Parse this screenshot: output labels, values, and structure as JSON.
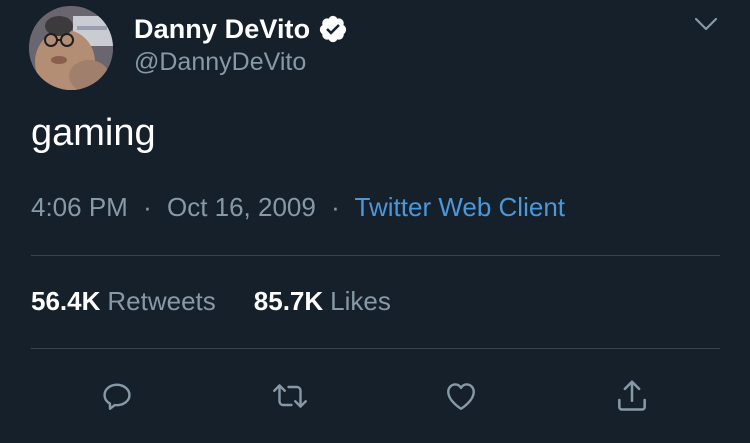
{
  "tweet": {
    "author": {
      "display_name": "Danny DeVito",
      "handle": "@DannyDeVito",
      "verified": true
    },
    "text": "gaming",
    "time": "4:06 PM",
    "date": "Oct 16, 2009",
    "separator": "·",
    "source": "Twitter Web Client",
    "stats": {
      "retweets_count": "56.4K",
      "retweets_label": "Retweets",
      "likes_count": "85.7K",
      "likes_label": "Likes"
    }
  },
  "icons": {
    "caret": "chevron-down-icon",
    "verified": "verified-badge-icon",
    "reply": "reply-icon",
    "retweet": "retweet-icon",
    "like": "heart-icon",
    "share": "share-icon"
  },
  "colors": {
    "background": "#15202b",
    "primary_text": "#ffffff",
    "secondary_text": "#8899a6",
    "link": "#4a97d9",
    "divider": "#38444d"
  }
}
